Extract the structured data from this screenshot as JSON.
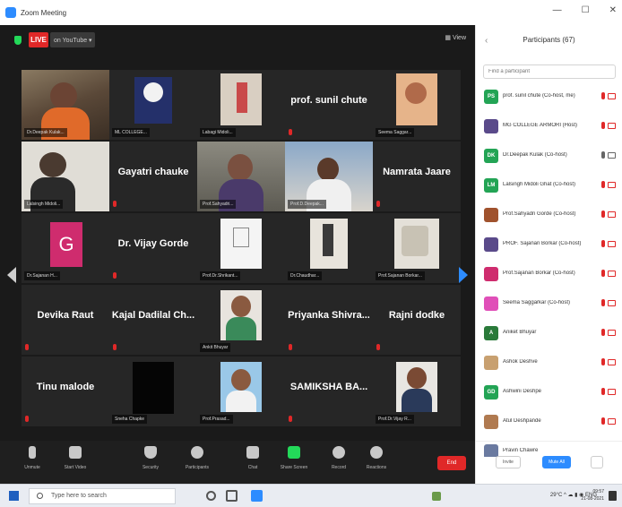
{
  "window": {
    "title": "Zoom Meeting",
    "controls": [
      "—",
      "☐",
      "✕"
    ]
  },
  "meeting": {
    "live_badge": "LIVE",
    "live_destination": "on YouTube ▾",
    "view_label": "▦ View",
    "tiles": [
      {
        "name": "",
        "label": "Dr.Deepak Kulak..."
      },
      {
        "name": "",
        "label": "ML COLLEGE..."
      },
      {
        "name": "",
        "label": "Labagi Midoli..."
      },
      {
        "name": "prof. sunil chute",
        "label": ""
      },
      {
        "name": "",
        "label": "Seema Saggar..."
      },
      {
        "name": "",
        "label": "Lalsingh Midoli..."
      },
      {
        "name": "Gayatri chauke",
        "label": ""
      },
      {
        "name": "",
        "label": "Prof.Sahyadri..."
      },
      {
        "name": "",
        "label": "Prof.D.Deepak..."
      },
      {
        "name": "Namrata Jaare",
        "label": ""
      },
      {
        "name": "",
        "label": "Dr.Sajanan H..."
      },
      {
        "name": "Dr. Vijay Gorde",
        "label": ""
      },
      {
        "name": "",
        "label": "Prof.Dr.Shrikant..."
      },
      {
        "name": "",
        "label": "Dr.Chaudhar..."
      },
      {
        "name": "",
        "label": "Prof.Sajanan Borkar..."
      },
      {
        "name": "Devika Raut",
        "label": ""
      },
      {
        "name": "Kajal Dadilal Ch...",
        "label": ""
      },
      {
        "name": "",
        "label": "Ankit Bhuyar"
      },
      {
        "name": "Priyanka Shivra...",
        "label": ""
      },
      {
        "name": "Rajni dodke",
        "label": ""
      },
      {
        "name": "Tinu malode",
        "label": ""
      },
      {
        "name": "",
        "label": "Sneha Chapke"
      },
      {
        "name": "",
        "label": "Prof.Prasad..."
      },
      {
        "name": "SAMIKSHA BA...",
        "label": ""
      },
      {
        "name": "",
        "label": "Prof.Dr.Vijay R..."
      }
    ],
    "avatar_letter": "G"
  },
  "toolbar": {
    "items": [
      "Unmute",
      "Start Video",
      "Security",
      "Participants",
      "Chat",
      "Share Screen",
      "Record",
      "Reactions"
    ],
    "participant_count": "67",
    "end_label": "End"
  },
  "participants_panel": {
    "title": "Participants (67)",
    "search_placeholder": "Find a participant",
    "list": [
      {
        "initials": "PS",
        "name": "prof. sunil chute (Co-host, me)",
        "color": "#23a455"
      },
      {
        "initials": "",
        "name": "MG COLLEGE ARMORI (Host)",
        "color": "#5a4a8a"
      },
      {
        "initials": "DK",
        "name": "Dr.Deepak Kulak (Co-host)",
        "color": "#23a455"
      },
      {
        "initials": "LM",
        "name": "Lalsingh Midoli Ghat (Co-host)",
        "color": "#23a455"
      },
      {
        "initials": "",
        "name": "Prof.Sahyadri Gorde (Co-host)",
        "color": "#a0522d"
      },
      {
        "initials": "",
        "name": "PROF. Sajanan Borkar (Co-host)",
        "color": "#5a4a8a"
      },
      {
        "initials": "",
        "name": "Prof.Sajanan Borkar (Co-host)",
        "color": "#cf2c6e"
      },
      {
        "initials": "",
        "name": "Seema Saggarkar (Co-host)",
        "color": "#e04fb8"
      },
      {
        "initials": "A",
        "name": "Aniket Bhuyar",
        "color": "#2a7a3a"
      },
      {
        "initials": "",
        "name": "Ashok Deshve",
        "color": "#c8a070"
      },
      {
        "initials": "GD",
        "name": "Ashwini Deshpe",
        "color": "#23a455"
      },
      {
        "initials": "",
        "name": "Atul Deshpande",
        "color": "#b07a50"
      },
      {
        "initials": "",
        "name": "Pravin Chawre",
        "color": "#6a7aa0"
      }
    ],
    "invite_label": "Invite",
    "mute_all_label": "Mute All"
  },
  "taskbar": {
    "search_placeholder": "Type here to search",
    "tray_text": "29°C ^ ☁ ▮ ◉ ENG",
    "time": "09:57",
    "date": "21-08-2021"
  }
}
